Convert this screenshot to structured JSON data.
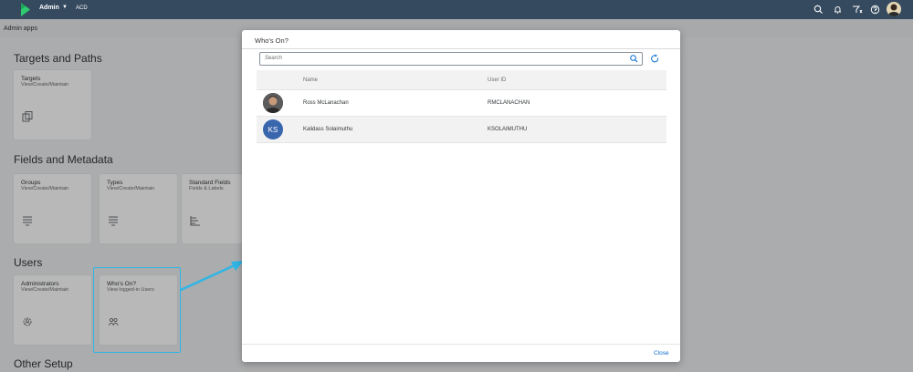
{
  "shell": {
    "app_title": "Admin",
    "system_id": "ACD",
    "icons": [
      "search-icon",
      "notification-bell-icon",
      "filter-icon",
      "help-icon",
      "user-avatar"
    ]
  },
  "page": {
    "title": "Admin apps",
    "sections": [
      {
        "title": "Targets and Paths",
        "tiles": [
          {
            "title": "Targets",
            "subtitle": "View/Create/Maintain",
            "icon": "copy-documents-icon"
          }
        ]
      },
      {
        "title": "Fields and Metadata",
        "tiles": [
          {
            "title": "Groups",
            "subtitle": "View/Create/Maintain",
            "icon": "list-icon"
          },
          {
            "title": "Types",
            "subtitle": "View/Create/Maintain",
            "icon": "list-icon"
          },
          {
            "title": "Standard Fields",
            "subtitle": "Fields & Labels",
            "icon": "hierarchy-icon"
          }
        ]
      },
      {
        "title": "Users",
        "tiles": [
          {
            "title": "Administrators",
            "subtitle": "View/Create/Maintain",
            "icon": "gear-user-icon"
          },
          {
            "title": "Who's On?",
            "subtitle": "View logged-in Users",
            "icon": "group-icon"
          }
        ]
      },
      {
        "title": "Other Setup",
        "tiles": []
      }
    ]
  },
  "dialog": {
    "title": "Who's On?",
    "search_placeholder": "Search",
    "columns": {
      "name": "Name",
      "user_id": "User ID"
    },
    "rows": [
      {
        "avatar": "photo",
        "name": "Ross McLanachan",
        "user_id": "RMCLANACHAN"
      },
      {
        "avatar": "KS",
        "name": "Kalidass Solaimuthu",
        "user_id": "KSOLAIMUTHU"
      }
    ],
    "close_label": "Close"
  },
  "colors": {
    "shell_bg": "#354a5f",
    "accent": "#0a6ed1",
    "highlight": "#2fb6e6",
    "avatar_bg": "#3a66ad"
  }
}
